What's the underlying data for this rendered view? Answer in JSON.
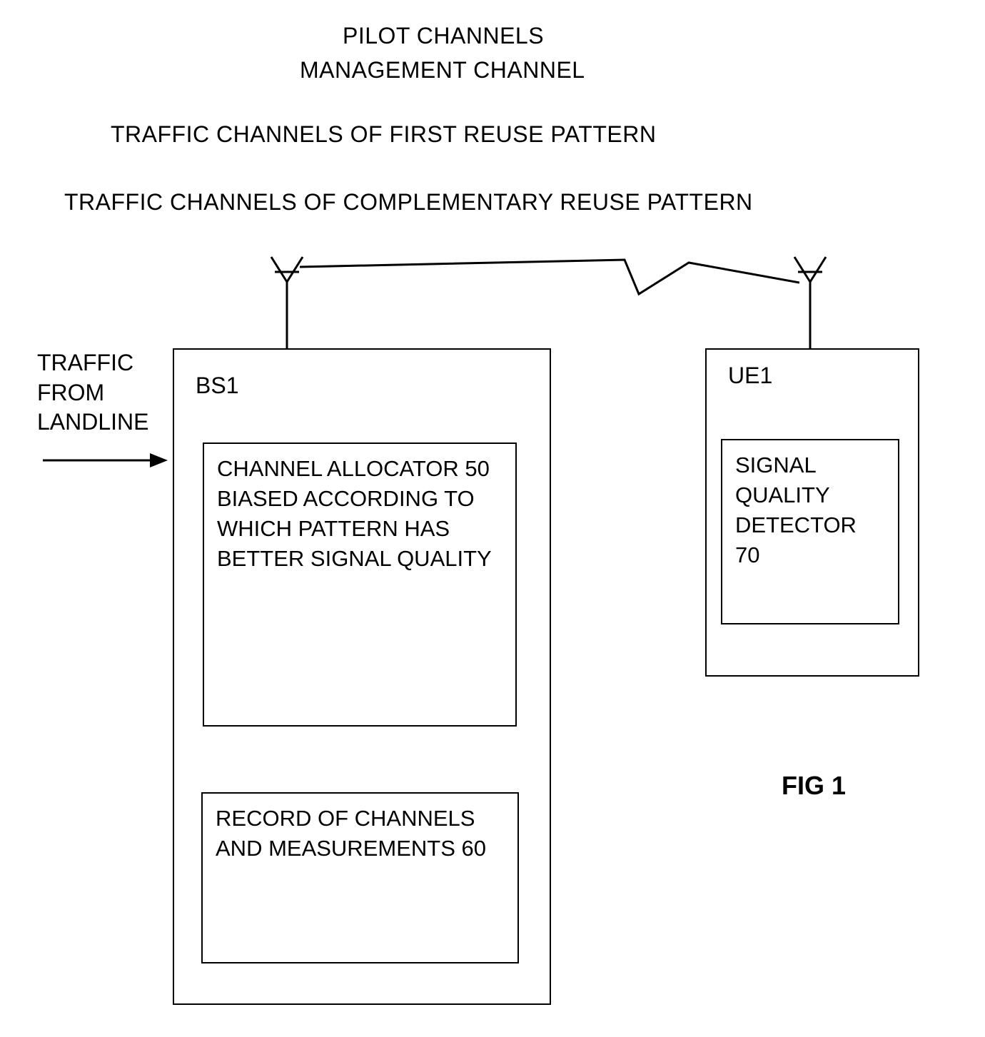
{
  "header": {
    "line1": "PILOT CHANNELS",
    "line2": "MANAGEMENT  CHANNEL",
    "line3": "TRAFFIC  CHANNELS OF FIRST REUSE PATTERN",
    "line4": "TRAFFIC  CHANNELS OF COMPLEMENTARY REUSE PATTERN"
  },
  "traffic_label": {
    "l1": "TRAFFIC",
    "l2": "FROM",
    "l3": "LANDLINE"
  },
  "bs": {
    "label": "BS1",
    "allocator": "CHANNEL ALLOCATOR 50 BIASED ACCORDING TO WHICH PATTERN HAS BETTER SIGNAL QUALITY",
    "record": "RECORD OF CHANNELS AND MEASUREMENTS 60"
  },
  "ue": {
    "label": "UE1",
    "detector": "SIGNAL QUALITY DETECTOR 70"
  },
  "figure": "FIG 1"
}
